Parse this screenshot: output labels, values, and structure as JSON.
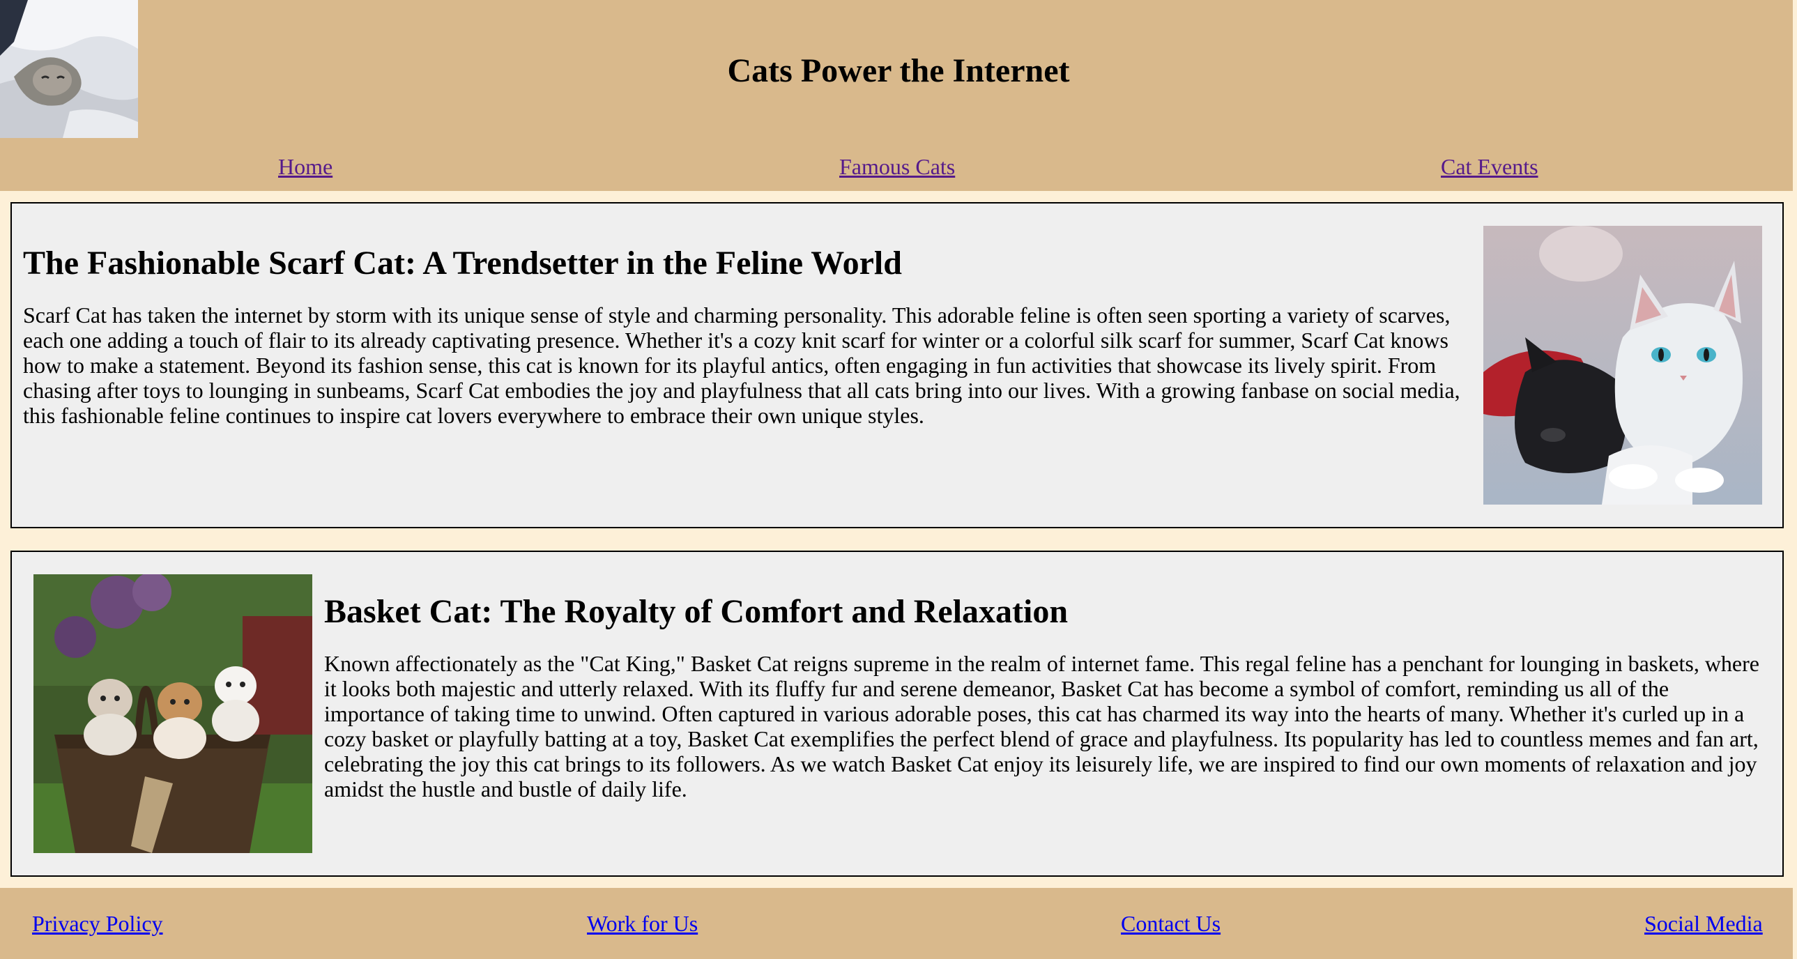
{
  "header": {
    "logo": "cat-under-blanket-photo",
    "title": "Cats Power the Internet"
  },
  "nav": {
    "items": [
      {
        "label": "Home"
      },
      {
        "label": "Famous Cats"
      },
      {
        "label": "Cat Events"
      }
    ]
  },
  "articles": [
    {
      "title": "The Fashionable Scarf Cat: A Trendsetter in the Feline World",
      "body": "Scarf Cat has taken the internet by storm with its unique sense of style and charming personality. This adorable feline is often seen sporting a variety of scarves, each one adding a touch of flair to its already captivating presence. Whether it's a cozy knit scarf for winter or a colorful silk scarf for summer, Scarf Cat knows how to make a statement. Beyond its fashion sense, this cat is known for its playful antics, often engaging in fun activities that showcase its lively spirit. From chasing after toys to lounging in sunbeams, Scarf Cat embodies the joy and playfulness that all cats bring into our lives. With a growing fanbase on social media, this fashionable feline continues to inspire cat lovers everywhere to embrace their own unique styles.",
      "image": "two-kittens-photo"
    },
    {
      "title": "Basket Cat: The Royalty of Comfort and Relaxation",
      "body": "Known affectionately as the \"Cat King,\" Basket Cat reigns supreme in the realm of internet fame. This regal feline has a penchant for lounging in baskets, where it looks both majestic and utterly relaxed. With its fluffy fur and serene demeanor, Basket Cat has become a symbol of comfort, reminding us all of the importance of taking time to unwind. Often captured in various adorable poses, this cat has charmed its way into the hearts of many. Whether it's curled up in a cozy basket or playfully batting at a toy, Basket Cat exemplifies the perfect blend of grace and playfulness. Its popularity has led to countless memes and fan art, celebrating the joy this cat brings to its followers. As we watch Basket Cat enjoy its leisurely life, we are inspired to find our own moments of relaxation and joy amidst the hustle and bustle of daily life.",
      "image": "kittens-in-basket-photo"
    }
  ],
  "footer": {
    "links": [
      {
        "label": "Privacy Policy"
      },
      {
        "label": "Work for Us"
      },
      {
        "label": "Contact Us"
      },
      {
        "label": "Social Media"
      }
    ]
  },
  "colors": {
    "header_bg": "#d9b98c",
    "page_bg": "#fdf0d8",
    "card_bg": "#efefef",
    "visited_link": "#551a8b",
    "link": "#0000ee"
  }
}
